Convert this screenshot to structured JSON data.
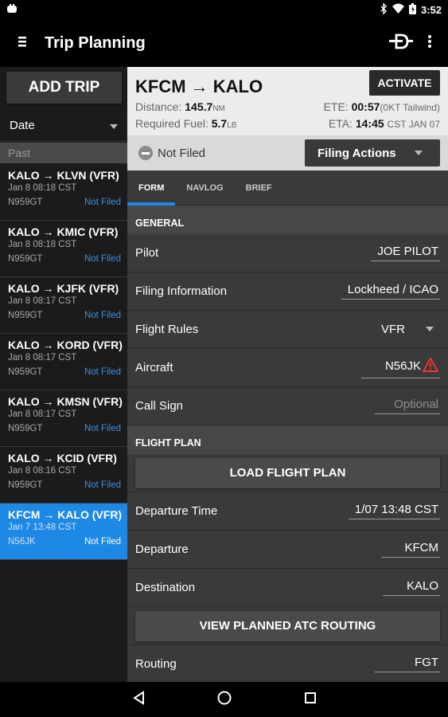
{
  "status_bar": {
    "time": "3:52"
  },
  "app_bar": {
    "title": "Trip Planning"
  },
  "sidebar": {
    "add_trip_label": "ADD TRIP",
    "sort_label": "Date",
    "section_label": "Past",
    "trips": [
      {
        "route": "KALO → KLVN (VFR)",
        "date": "Jan 8 08:18 CST",
        "tail": "N959GT",
        "status": "Not Filed"
      },
      {
        "route": "KALO → KMIC (VFR)",
        "date": "Jan 8 08:18 CST",
        "tail": "N959GT",
        "status": "Not Filed"
      },
      {
        "route": "KALO → KJFK (VFR)",
        "date": "Jan 8 08:17 CST",
        "tail": "N959GT",
        "status": "Not Filed"
      },
      {
        "route": "KALO → KORD (VFR)",
        "date": "Jan 8 08:17 CST",
        "tail": "N959GT",
        "status": "Not Filed"
      },
      {
        "route": "KALO → KMSN (VFR)",
        "date": "Jan 8 08:17 CST",
        "tail": "N959GT",
        "status": "Not Filed"
      },
      {
        "route": "KALO → KCID (VFR)",
        "date": "Jan 8 08:16 CST",
        "tail": "N959GT",
        "status": "Not Filed"
      },
      {
        "route": "KFCM → KALO (VFR)",
        "date": "Jan 7 13:48 CST",
        "tail": "N56JK",
        "status": "Not Filed"
      }
    ]
  },
  "header": {
    "route": "KFCM → KALO",
    "activate_label": "ACTIVATE",
    "distance_label": "Distance:",
    "distance_value": "145.7",
    "distance_unit": "NM",
    "fuel_label": "Required Fuel:",
    "fuel_value": "5.7",
    "fuel_unit": "LB",
    "ete_label": "ETE:",
    "ete_value": "00:57",
    "ete_note": "(0KT Tailwind)",
    "eta_label": "ETA:",
    "eta_value": "14:45",
    "eta_note": "CST JAN 07"
  },
  "filing": {
    "status": "Not Filed",
    "actions_label": "Filing Actions"
  },
  "tabs": [
    {
      "label": "FORM"
    },
    {
      "label": "NAVLOG"
    },
    {
      "label": "BRIEF"
    }
  ],
  "form": {
    "general_header": "GENERAL",
    "pilot_label": "Pilot",
    "pilot_value": "JOE PILOT",
    "filing_info_label": "Filing Information",
    "filing_info_value": "Lockheed / ICAO",
    "flight_rules_label": "Flight Rules",
    "flight_rules_value": "VFR",
    "aircraft_label": "Aircraft",
    "aircraft_value": "N56JK",
    "call_sign_label": "Call Sign",
    "call_sign_placeholder": "Optional",
    "flight_plan_header": "FLIGHT PLAN",
    "load_flight_plan_label": "LOAD FLIGHT PLAN",
    "departure_time_label": "Departure Time",
    "departure_time_value": "1/07 13:48 CST",
    "departure_label": "Departure",
    "departure_value": "KFCM",
    "destination_label": "Destination",
    "destination_value": "KALO",
    "view_routing_label": "VIEW PLANNED ATC ROUTING",
    "routing_label": "Routing",
    "routing_value": "FGT"
  },
  "colors": {
    "accent": "#1e88e5",
    "warning": "#e53935"
  }
}
